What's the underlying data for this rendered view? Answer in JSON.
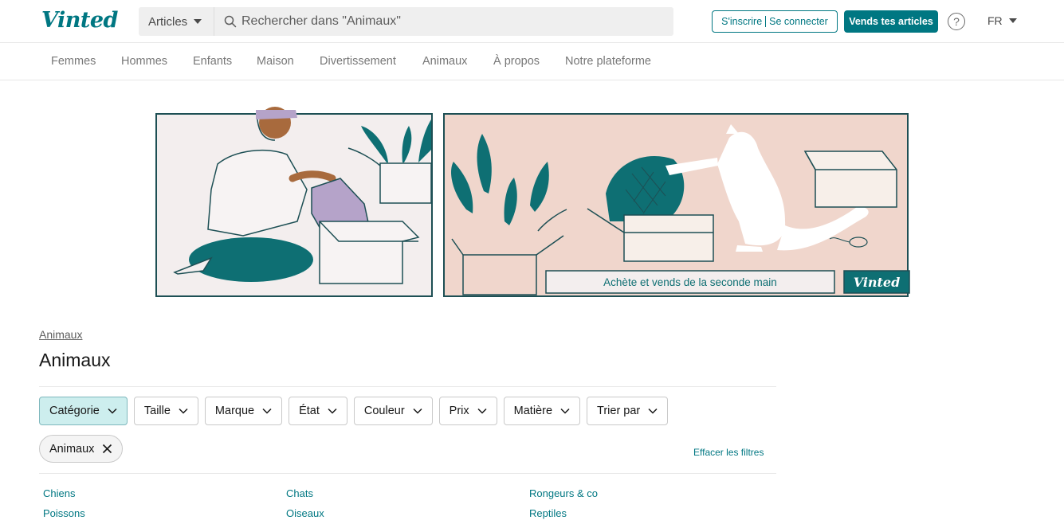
{
  "header": {
    "logo": "Vinted",
    "search_scope": "Articles",
    "search_placeholder": "Rechercher dans \"Animaux\"",
    "signup": "S'inscrire",
    "login": "Se connecter",
    "sell": "Vends tes articles",
    "help": "?",
    "lang": "FR"
  },
  "nav": [
    "Femmes",
    "Hommes",
    "Enfants",
    "Maison",
    "Divertissement",
    "Animaux",
    "À propos",
    "Notre plateforme"
  ],
  "banner": {
    "tagline": "Achète et vends de la seconde main",
    "logo": "Vinted"
  },
  "breadcrumb": "Animaux",
  "title": "Animaux",
  "filters": [
    "Catégorie",
    "Taille",
    "Marque",
    "État",
    "Couleur",
    "Prix",
    "Matière",
    "Trier par"
  ],
  "active_chip": "Animaux",
  "clear_filters": "Effacer les filtres",
  "categories": [
    "Chiens",
    "Chats",
    "Rongeurs & co",
    "Poissons",
    "Oiseaux",
    "Reptiles"
  ],
  "colors": {
    "brand": "#007782",
    "banner_left": "#f3eeee",
    "banner_right": "#f0d6cc"
  }
}
